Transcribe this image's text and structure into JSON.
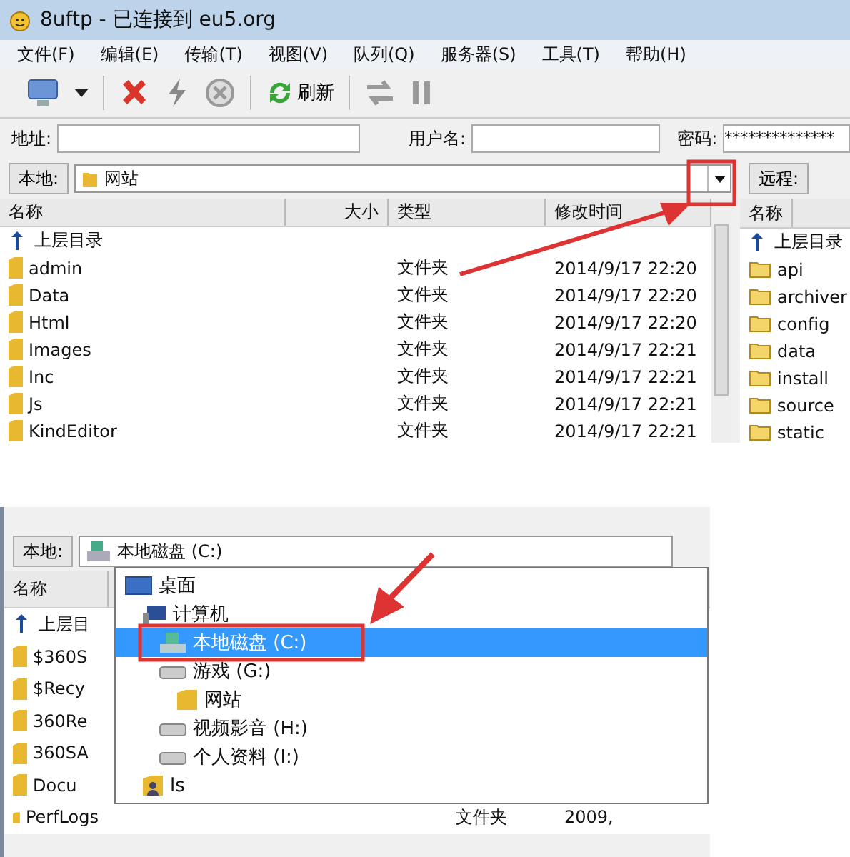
{
  "window": {
    "title": "8uftp - 已连接到 eu5.org"
  },
  "menu": [
    "文件(F)",
    "编辑(E)",
    "传输(T)",
    "视图(V)",
    "队列(Q)",
    "服务器(S)",
    "工具(T)",
    "帮助(H)"
  ],
  "toolbar": {
    "refresh_label": "刷新"
  },
  "connection": {
    "address_label": "地址:",
    "user_label": "用户名:",
    "password_label": "密码:",
    "password_value": "**************"
  },
  "local_pane": {
    "label": "本地:",
    "path": "网站",
    "columns": [
      "名称",
      "大小",
      "类型",
      "修改时间"
    ],
    "parent_label": "上层目录",
    "rows": [
      {
        "name": "admin",
        "type": "文件夹",
        "modified": "2014/9/17 22:20"
      },
      {
        "name": "Data",
        "type": "文件夹",
        "modified": "2014/9/17 22:20"
      },
      {
        "name": "Html",
        "type": "文件夹",
        "modified": "2014/9/17 22:20"
      },
      {
        "name": "Images",
        "type": "文件夹",
        "modified": "2014/9/17 22:21"
      },
      {
        "name": "Inc",
        "type": "文件夹",
        "modified": "2014/9/17 22:21"
      },
      {
        "name": "Js",
        "type": "文件夹",
        "modified": "2014/9/17 22:21"
      },
      {
        "name": "KindEditor",
        "type": "文件夹",
        "modified": "2014/9/17 22:21"
      }
    ]
  },
  "remote_pane": {
    "label": "远程:",
    "column": "名称",
    "parent_label": "上层目录",
    "rows": [
      "api",
      "archiver",
      "config",
      "data",
      "install",
      "source",
      "static"
    ]
  },
  "second_view": {
    "label": "本地:",
    "path": "本地磁盘 (C:)",
    "column": "名称",
    "parent_label": "上层目",
    "rows": [
      {
        "name": "$360S"
      },
      {
        "name": "$Recy"
      },
      {
        "name": "360Re"
      },
      {
        "name": "360SA"
      },
      {
        "name": "Docu"
      },
      {
        "name": "PerfLogs",
        "type": "文件夹",
        "modified": "2009,"
      }
    ],
    "dropdown": [
      {
        "label": "桌面",
        "kind": "desktop",
        "selected": false,
        "children": [
          {
            "label": "计算机",
            "kind": "computer",
            "selected": false,
            "children": [
              {
                "label": "本地磁盘 (C:)",
                "kind": "system-drive",
                "selected": true
              },
              {
                "label": "游戏 (G:)",
                "kind": "drive",
                "selected": false,
                "children": [
                  {
                    "label": "网站",
                    "kind": "folder",
                    "selected": false
                  }
                ]
              },
              {
                "label": "视频影音 (H:)",
                "kind": "drive",
                "selected": false
              },
              {
                "label": "个人资料 (I:)",
                "kind": "drive",
                "selected": false
              }
            ]
          },
          {
            "label": "ls",
            "kind": "user-folder",
            "selected": false
          }
        ]
      }
    ]
  }
}
